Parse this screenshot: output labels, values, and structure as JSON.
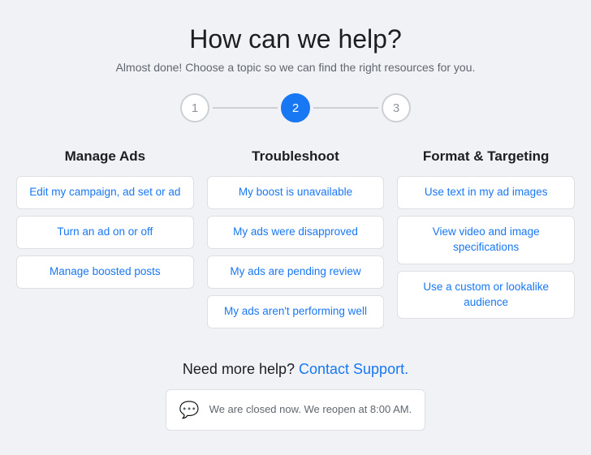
{
  "header": {
    "title": "How can we help?",
    "subtitle": "Almost done! Choose a topic so we can find the right resources for you."
  },
  "stepper": {
    "steps": [
      {
        "label": "1",
        "active": false
      },
      {
        "label": "2",
        "active": true
      },
      {
        "label": "3",
        "active": false
      }
    ]
  },
  "columns": [
    {
      "title": "Manage Ads",
      "options": [
        "Edit my campaign, ad set or ad",
        "Turn an ad on or off",
        "Manage boosted posts"
      ]
    },
    {
      "title": "Troubleshoot",
      "options": [
        "My boost is unavailable",
        "My ads were disapproved",
        "My ads are pending review",
        "My ads aren't performing well"
      ]
    },
    {
      "title": "Format & Targeting",
      "options": [
        "Use text in my ad images",
        "View video and image specifications",
        "Use a custom or lookalike audience"
      ]
    }
  ],
  "contact": {
    "title": "Need more help? Contact Support.",
    "contact_link_text": "Contact Support",
    "closed_message": "We are closed now. We reopen at 8:00 AM."
  }
}
